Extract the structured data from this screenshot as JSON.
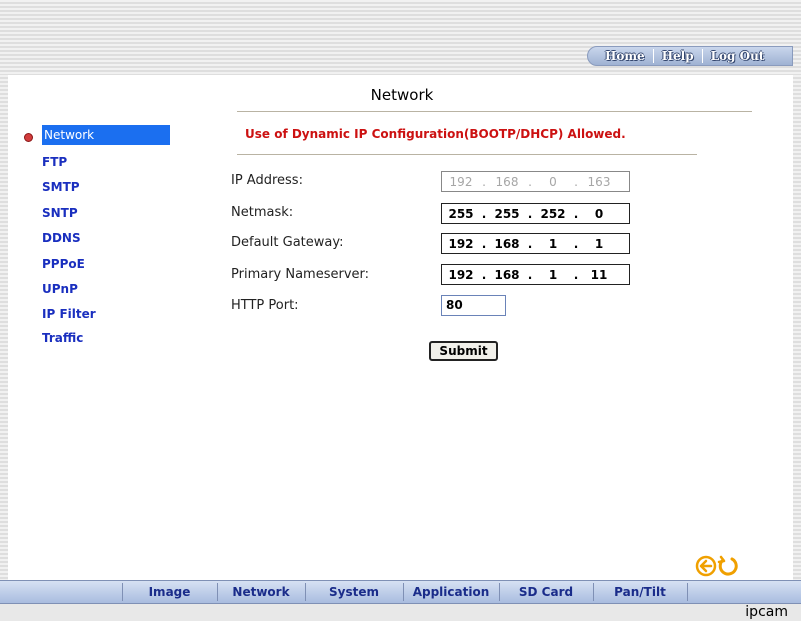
{
  "header": {
    "nav": [
      "Home",
      "Help",
      "Log Out"
    ]
  },
  "page": {
    "title": "Network",
    "notice": "Use of Dynamic IP Configuration(BOOTP/DHCP) Allowed."
  },
  "sidebar": {
    "items": [
      {
        "label": "Network",
        "active": true
      },
      {
        "label": "FTP"
      },
      {
        "label": "SMTP"
      },
      {
        "label": "SNTP"
      },
      {
        "label": "DDNS"
      },
      {
        "label": "PPPoE"
      },
      {
        "label": "UPnP"
      },
      {
        "label": "IP Filter"
      },
      {
        "label": "Traffic"
      }
    ]
  },
  "form": {
    "ip_address": {
      "label": "IP Address:",
      "parts": [
        "192",
        "168",
        "0",
        "163"
      ]
    },
    "netmask": {
      "label": "Netmask:",
      "parts": [
        "255",
        "255",
        "252",
        "0"
      ]
    },
    "gateway": {
      "label": "Default Gateway:",
      "parts": [
        "192",
        "168",
        "1",
        "1"
      ]
    },
    "nameserver": {
      "label": "Primary Nameserver:",
      "parts": [
        "192",
        "168",
        "1",
        "11"
      ]
    },
    "http_port": {
      "label": "HTTP Port:",
      "value": "80"
    },
    "ip_separator": ".",
    "submit_label": "Submit"
  },
  "icons": {
    "back": "back-arrow-icon",
    "refresh": "refresh-icon"
  },
  "tabs": [
    "Image",
    "Network",
    "System",
    "Application",
    "SD Card",
    "Pan/Tilt"
  ],
  "footer": {
    "brand": "ipcam"
  },
  "colors": {
    "accent": "#1b6ff0",
    "notice": "#cc1111",
    "link": "#1a2fbf",
    "icon": "#f0a000"
  }
}
